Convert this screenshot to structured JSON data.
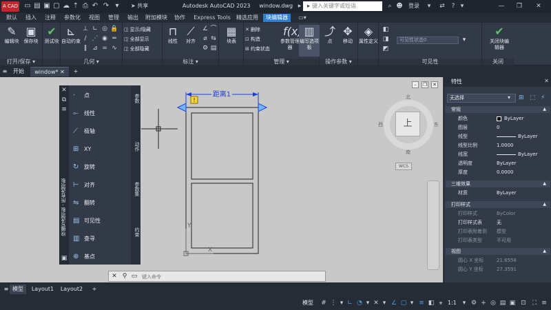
{
  "titlebar": {
    "logo_text": "A CAD",
    "share_label": "共享",
    "app_title": "Autodesk AutoCAD 2023",
    "file_title": "window.dwg",
    "search_placeholder": "键入关键字或短语",
    "signin_label": "登录"
  },
  "ribbon_tabs": [
    "默认",
    "插入",
    "注释",
    "参数化",
    "视图",
    "管理",
    "输出",
    "附加模块",
    "协作",
    "Express Tools",
    "精选应用",
    "块编辑器"
  ],
  "ribbon": {
    "open_save": {
      "title": "打开/保存",
      "edit_block": "编辑块",
      "save_block": "保存块"
    },
    "test": {
      "title": "",
      "test_block": "测试块"
    },
    "geometry": {
      "title": "几何",
      "auto_constrain": "自动约束"
    },
    "visibility_group": {
      "show_hide": "显示/隐藏",
      "show_all": "全部显示",
      "hide_all": "全部隐藏"
    },
    "dimensional": {
      "title": "标注",
      "linear": "线性",
      "aligned": "对齐"
    },
    "block_table": "块表",
    "manage": {
      "title": "管理",
      "delete": "删除",
      "constrain": "构造",
      "constraint_state": "约束状态",
      "param_manager": "参数管理器",
      "authoring_palettes": "编写选项板"
    },
    "action_params": {
      "title": "操作参数",
      "point": "点",
      "move": "移动"
    },
    "attribute_def": "属性定义",
    "visibility": {
      "title": "可见性",
      "combo_value": "可见性状态0"
    },
    "close": {
      "title": "关闭",
      "close_editor": "关闭块编辑器"
    }
  },
  "file_tabs": {
    "start": "开始",
    "active": "window*",
    "add": "+"
  },
  "palette": {
    "title": "块编写选项板 - 所有选项板",
    "items": [
      "点",
      "线性",
      "极轴",
      "XY",
      "旋转",
      "对齐",
      "翻转",
      "可见性",
      "查寻",
      "基点"
    ],
    "tabs": [
      "参数",
      "动作",
      "参数集",
      "约束"
    ]
  },
  "drawing": {
    "dimension_label": "距离1",
    "param_marker": "!",
    "ucs_y": "Y",
    "ucs_x": "X"
  },
  "viewcube": {
    "face": "上",
    "north": "北",
    "south": "南",
    "west": "西",
    "east": "东",
    "wcs": "WCS"
  },
  "command": {
    "placeholder": "键入命令"
  },
  "properties": {
    "title": "特性",
    "selection": "无选择",
    "sections": {
      "general": "常规",
      "3d": "三维效果",
      "plot": "打印样式",
      "view": "视图"
    },
    "general_rows": [
      {
        "k": "颜色",
        "v": "ByLayer"
      },
      {
        "k": "图层",
        "v": "0"
      },
      {
        "k": "线型",
        "v": "ByLayer"
      },
      {
        "k": "线型比例",
        "v": "1.0000"
      },
      {
        "k": "线宽",
        "v": "ByLayer"
      },
      {
        "k": "透明度",
        "v": "ByLayer"
      },
      {
        "k": "厚度",
        "v": "0.0000"
      }
    ],
    "three_d_rows": [
      {
        "k": "材质",
        "v": "ByLayer"
      }
    ],
    "plot_rows": [
      {
        "k": "打印样式",
        "v": "ByColor"
      },
      {
        "k": "打印样式表",
        "v": "无"
      },
      {
        "k": "打印表附着到",
        "v": "模型"
      },
      {
        "k": "打印表类型",
        "v": "不可用"
      }
    ],
    "view_rows": [
      {
        "k": "圆心 X 坐标",
        "v": "21.6558"
      },
      {
        "k": "圆心 Y 坐标",
        "v": "27.3591"
      }
    ]
  },
  "layout_tabs": [
    "模型",
    "Layout1",
    "Layout2",
    "+"
  ],
  "status": {
    "model": "模型",
    "scale": "1:1"
  }
}
